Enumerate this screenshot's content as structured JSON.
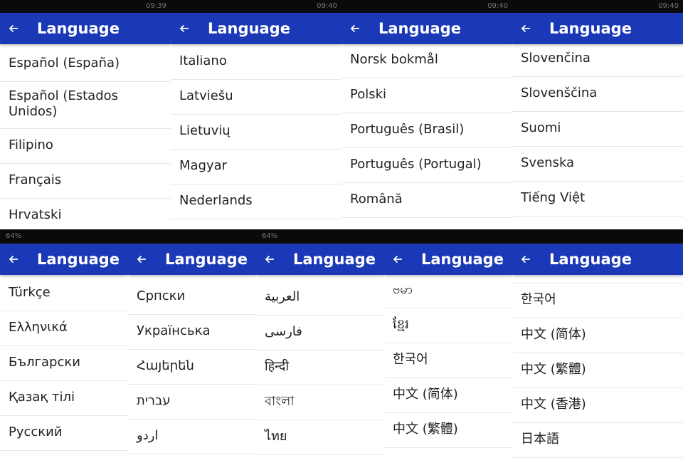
{
  "status_top": [
    "09:39",
    "09:40",
    "09:40",
    "09:40"
  ],
  "status_bottom": [
    "64%",
    "64%"
  ],
  "screens_top": [
    {
      "title": "Language",
      "items": [
        "Español (España)",
        "Español (Estados Unidos)",
        "Filipino",
        "Français",
        "Hrvatski"
      ]
    },
    {
      "title": "Language",
      "items": [
        "Italiano",
        "Latviešu",
        "Lietuvių",
        "Magyar",
        "Nederlands"
      ]
    },
    {
      "title": "Language",
      "items": [
        "Norsk bokmål",
        "Polski",
        "Português (Brasil)",
        "Português (Portugal)",
        "Română"
      ]
    },
    {
      "title": "Language",
      "items": [
        "Slovenčina",
        "Slovenščina",
        "Suomi",
        "Svenska",
        "Tiếng Việt"
      ]
    }
  ],
  "screens_bottom": [
    {
      "title": "Language",
      "items": [
        "Türkçe",
        "Ελληνικά",
        "Български",
        "Қазақ тілі",
        "Русский"
      ]
    },
    {
      "title": "Language",
      "items": [
        "Српски",
        "Українська",
        "Հայերեն",
        "עברית",
        "اردو"
      ]
    },
    {
      "title": "Language",
      "items": [
        "العربية",
        "فارسی",
        "हिन्दी",
        "বাংলা",
        "ไทย"
      ]
    },
    {
      "title": "Language",
      "items": [
        "ဗမာ",
        "ខ្មែរ",
        "한국어",
        "中文 (简体)",
        "中文 (繁體)"
      ]
    },
    {
      "title": "Language",
      "items": [
        "한국어",
        "中文 (简体)",
        "中文 (繁體)",
        "中文 (香港)",
        "日本語"
      ]
    }
  ],
  "icons": {
    "back": "arrow-left-icon"
  },
  "colors": {
    "appbar": "#1b39b6",
    "divider": "#e6e6e6",
    "text": "#222222"
  }
}
